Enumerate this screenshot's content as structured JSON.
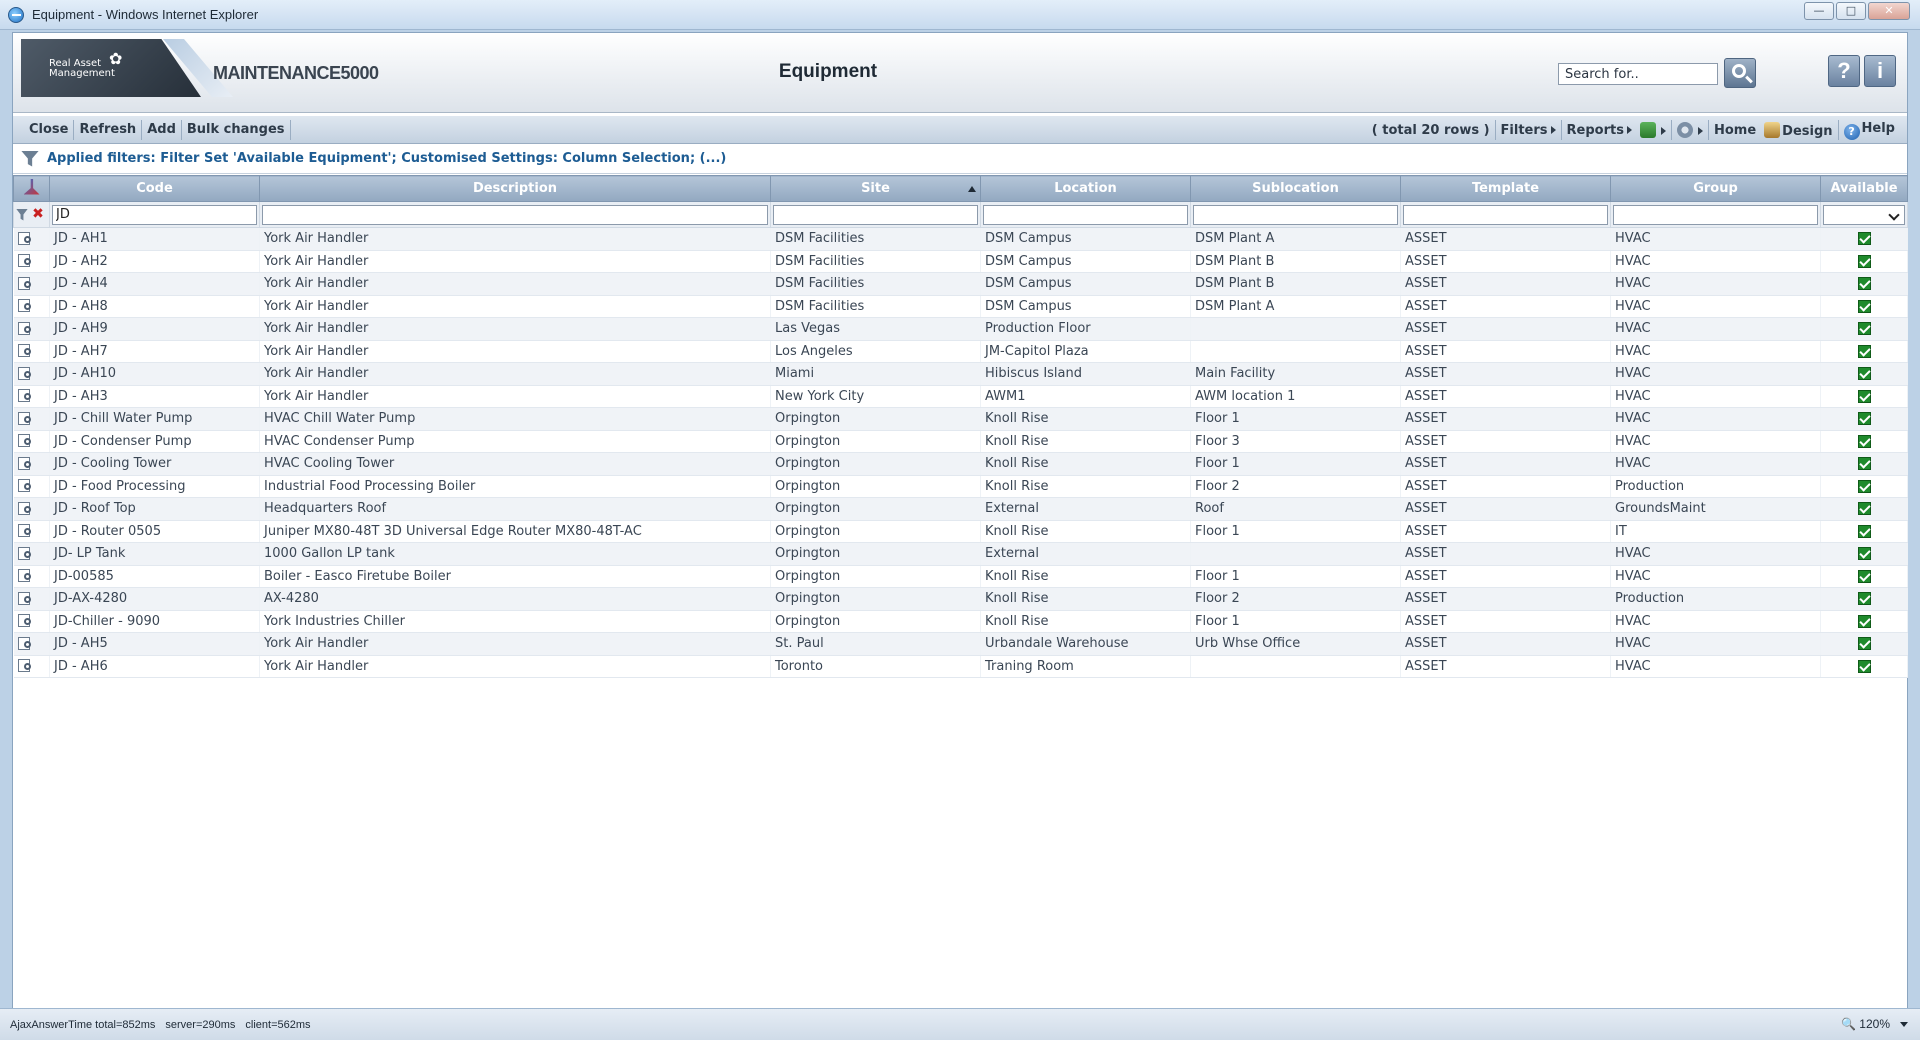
{
  "window": {
    "title": "Equipment - Windows Internet Explorer",
    "controls": [
      "—",
      "□",
      "✕"
    ]
  },
  "header": {
    "logo_text": "Real Asset Management",
    "product": "MAINTENANCE5000",
    "page_title": "Equipment",
    "search_placeholder": "Search for..",
    "help_glyph": "?",
    "info_glyph": "i"
  },
  "toolbar": {
    "close": "Close",
    "refresh": "Refresh",
    "add": "Add",
    "bulk": "Bulk changes",
    "total": "( total 20 rows )",
    "filters": "Filters",
    "reports": "Reports",
    "home": "Home",
    "design": "Design",
    "help": "Help"
  },
  "filters_bar": {
    "text": "Applied filters: Filter Set 'Available Equipment'; Customised Settings: Column Selection; (...)"
  },
  "table": {
    "columns": [
      "Code",
      "Description",
      "Site",
      "Location",
      "Sublocation",
      "Template",
      "Group",
      "Available"
    ],
    "filter_code": "JD",
    "rows": [
      [
        "JD - AH1",
        "York Air Handler",
        "DSM Facilities",
        "DSM Campus",
        "DSM Plant A",
        "ASSET",
        "HVAC"
      ],
      [
        "JD - AH2",
        "York Air Handler",
        "DSM Facilities",
        "DSM Campus",
        "DSM Plant B",
        "ASSET",
        "HVAC"
      ],
      [
        "JD - AH4",
        "York Air Handler",
        "DSM Facilities",
        "DSM Campus",
        "DSM Plant B",
        "ASSET",
        "HVAC"
      ],
      [
        "JD - AH8",
        "York Air Handler",
        "DSM Facilities",
        "DSM Campus",
        "DSM Plant A",
        "ASSET",
        "HVAC"
      ],
      [
        "JD - AH9",
        "York Air Handler",
        "Las Vegas",
        "Production Floor",
        "",
        "ASSET",
        "HVAC"
      ],
      [
        "JD - AH7",
        "York Air Handler",
        "Los Angeles",
        "JM-Capitol Plaza",
        "",
        "ASSET",
        "HVAC"
      ],
      [
        "JD - AH10",
        "York Air Handler",
        "Miami",
        "Hibiscus Island",
        "Main Facility",
        "ASSET",
        "HVAC"
      ],
      [
        "JD - AH3",
        "York Air Handler",
        "New York City",
        "AWM1",
        "AWM location 1",
        "ASSET",
        "HVAC"
      ],
      [
        "JD - Chill Water Pump",
        "HVAC Chill Water Pump",
        "Orpington",
        "Knoll Rise",
        "Floor 1",
        "ASSET",
        "HVAC"
      ],
      [
        "JD - Condenser Pump",
        "HVAC Condenser Pump",
        "Orpington",
        "Knoll Rise",
        "Floor 3",
        "ASSET",
        "HVAC"
      ],
      [
        "JD - Cooling Tower",
        "HVAC Cooling Tower",
        "Orpington",
        "Knoll Rise",
        "Floor 1",
        "ASSET",
        "HVAC"
      ],
      [
        "JD - Food Processing",
        "Industrial Food Processing Boiler",
        "Orpington",
        "Knoll Rise",
        "Floor 2",
        "ASSET",
        "Production"
      ],
      [
        "JD - Roof Top",
        "Headquarters Roof",
        "Orpington",
        "External",
        "Roof",
        "ASSET",
        "GroundsMaint"
      ],
      [
        "JD - Router 0505",
        "Juniper MX80-48T 3D Universal Edge Router MX80-48T-AC",
        "Orpington",
        "Knoll Rise",
        "Floor 1",
        "ASSET",
        "IT"
      ],
      [
        "JD- LP Tank",
        "1000 Gallon LP tank",
        "Orpington",
        "External",
        "",
        "ASSET",
        "HVAC"
      ],
      [
        "JD-00585",
        "Boiler - Easco Firetube Boiler",
        "Orpington",
        "Knoll Rise",
        "Floor 1",
        "ASSET",
        "HVAC"
      ],
      [
        "JD-AX-4280",
        "AX-4280",
        "Orpington",
        "Knoll Rise",
        "Floor 2",
        "ASSET",
        "Production"
      ],
      [
        "JD-Chiller - 9090",
        "York Industries Chiller",
        "Orpington",
        "Knoll Rise",
        "Floor 1",
        "ASSET",
        "HVAC"
      ],
      [
        "JD - AH5",
        "York Air Handler",
        "St. Paul",
        "Urbandale Warehouse",
        "Urb Whse Office",
        "ASSET",
        "HVAC"
      ],
      [
        "JD - AH6",
        "York Air Handler",
        "Toronto",
        "Traning Room",
        "",
        "ASSET",
        "HVAC"
      ]
    ]
  },
  "status": {
    "ajax": "AjaxAnswerTime total=852ms",
    "server": "server=290ms",
    "client": "client=562ms",
    "zoom": "120%"
  },
  "colors": {
    "header_gradient_top": "#b4c5d8",
    "header_gradient_bottom": "#92a8c0",
    "filter_text": "#1d5c93",
    "check_green": "#1f8a2c"
  }
}
